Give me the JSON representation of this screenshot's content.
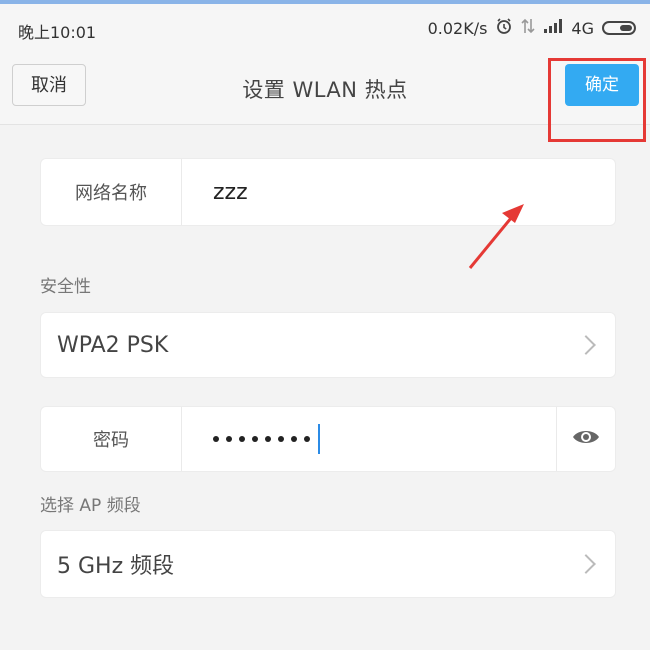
{
  "status_bar": {
    "time": "晚上10:01",
    "speed": "0.02K/s",
    "network": "4G"
  },
  "header": {
    "cancel_label": "取消",
    "title": "设置 WLAN 热点",
    "confirm_label": "确定"
  },
  "network_name": {
    "label": "网络名称",
    "value": "zzz"
  },
  "security": {
    "section_label": "安全性",
    "value": "WPA2 PSK"
  },
  "password": {
    "label": "密码",
    "masked_length": 8
  },
  "band": {
    "section_label": "选择 AP 频段",
    "value": "5 GHz 频段"
  },
  "colors": {
    "accent": "#33aaf2",
    "highlight_box": "#e53935"
  }
}
